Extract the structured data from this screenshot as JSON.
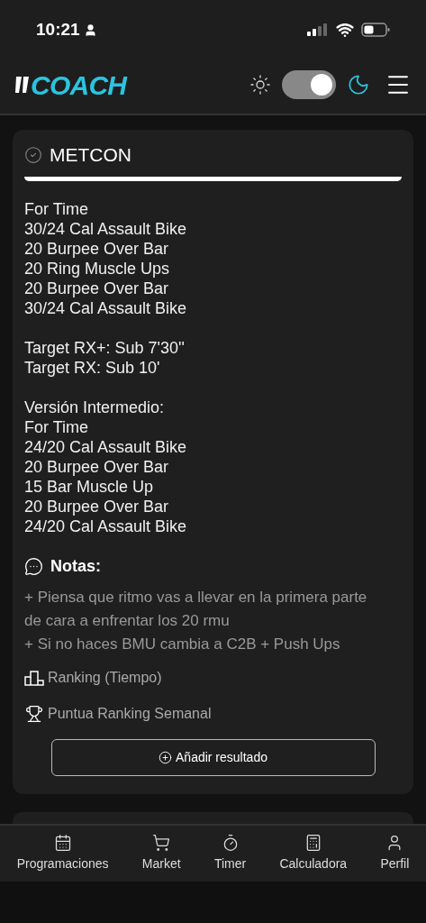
{
  "status_bar": {
    "time": "10:21"
  },
  "header": {
    "logo": "COACH",
    "dark_mode": {
      "on": true
    }
  },
  "card": {
    "title": "METCON",
    "done": true,
    "workout": [
      [
        "For Time",
        "30/24 Cal Assault Bike",
        "20 Burpee Over Bar",
        "20 Ring Muscle Ups",
        "20 Burpee Over Bar",
        "30/24 Cal Assault Bike"
      ],
      [
        "Target RX+: Sub 7'30''",
        "Target RX: Sub 10'"
      ],
      [
        "Versión Intermedio:",
        "For Time",
        "24/20 Cal Assault Bike",
        "20 Burpee Over Bar",
        "15 Bar Muscle Up",
        "20 Burpee Over Bar",
        "24/20 Cal Assault Bike"
      ]
    ],
    "notes": {
      "title": "Notas:",
      "lines": [
        "+ Piensa que ritmo vas a llevar en la primera parte de cara a enfrentar los 20 rmu",
        "+ Si no haces BMU cambia a C2B + Push Ups"
      ]
    },
    "info": [
      {
        "kind": "podium",
        "text": "Ranking (Tiempo)"
      },
      {
        "kind": "trophy",
        "text": "Puntua Ranking Semanal"
      }
    ],
    "button": "Añadir resultado"
  },
  "bottom_nav": [
    {
      "kind": "calendar",
      "label": "Programaciones"
    },
    {
      "kind": "cart",
      "label": "Market"
    },
    {
      "kind": "timer",
      "label": "Timer"
    },
    {
      "kind": "calculator",
      "label": "Calculadora"
    },
    {
      "kind": "user",
      "label": "Perfil"
    }
  ]
}
